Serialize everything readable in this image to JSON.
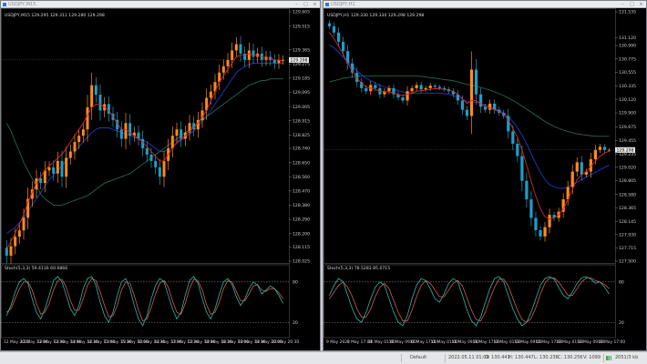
{
  "windows": [
    {
      "title": "USDJPY,M15",
      "symbol_line": "USDJPY,M15  129.295  129.311  129.280  129.298",
      "price_tag": "129.298",
      "y_ticks": [
        "129.605",
        "129.515",
        "129.365",
        "129.275",
        "129.185",
        "129.095",
        "129.005",
        "128.915",
        "128.825",
        "128.740",
        "128.650",
        "128.560",
        "128.470",
        "128.380",
        "128.290",
        "128.200",
        "128.115",
        "128.025"
      ],
      "time_labels": [
        "12 May 2022",
        "12 May 13:00",
        "12 May 13:30",
        "12 May 14:00",
        "12 May 14:30",
        "12 May 15:00",
        "12 May 15:30",
        "12 May 16:00",
        "12 May 16:30",
        "12 May 17:00",
        "12 May 17:30",
        "12 May 18:00",
        "12 May 18:30",
        "12 May 19:00",
        "12 May 19:30",
        "12 May 20:00",
        "12 May 20:30"
      ],
      "indicator_label": "Stoch(5,3,3) 59.4116 60.6866",
      "ind_levels": [
        "80",
        "20"
      ],
      "close_values": [
        128.06,
        128.12,
        128.18,
        128.22,
        128.3,
        128.42,
        128.48,
        128.55,
        128.52,
        128.6,
        128.62,
        128.58,
        128.66,
        128.56,
        128.68,
        128.72,
        128.78,
        128.82,
        128.86,
        129.0,
        129.14,
        129.08,
        128.98,
        129.02,
        128.96,
        128.92,
        128.86,
        128.8,
        128.9,
        128.82,
        128.84,
        128.8,
        128.74,
        128.7,
        128.66,
        128.62,
        128.56,
        128.66,
        128.74,
        128.82,
        128.86,
        128.8,
        128.84,
        128.9,
        128.86,
        128.92,
        128.98,
        129.06,
        129.1,
        129.16,
        129.22,
        129.26,
        129.3,
        129.36,
        129.4,
        129.34,
        129.3,
        129.36,
        129.32,
        129.34,
        129.3,
        129.32,
        129.3,
        129.28,
        129.3,
        129.3
      ],
      "ma_red": [
        128.1,
        128.15,
        128.2,
        128.26,
        128.32,
        128.4,
        128.46,
        128.52,
        128.56,
        128.6,
        128.63,
        128.65,
        128.68,
        128.7,
        128.74,
        128.78,
        128.82,
        128.86,
        128.9,
        128.95,
        129.0,
        129.02,
        129.02,
        129.0,
        128.98,
        128.94,
        128.9,
        128.86,
        128.86,
        128.84,
        128.82,
        128.8,
        128.78,
        128.75,
        128.72,
        128.69,
        128.66,
        128.66,
        128.7,
        128.74,
        128.78,
        128.8,
        128.82,
        128.85,
        128.87,
        128.9,
        128.94,
        128.98,
        129.04,
        129.1,
        129.16,
        129.2,
        129.24,
        129.28,
        129.32,
        129.33,
        129.33,
        129.34,
        129.33,
        129.33,
        129.32,
        129.31,
        129.31,
        129.3,
        129.3,
        129.29
      ],
      "ma_blue": [
        128.2,
        128.22,
        128.24,
        128.27,
        128.3,
        128.34,
        128.38,
        128.42,
        128.46,
        128.5,
        128.54,
        128.57,
        128.6,
        128.63,
        128.66,
        128.69,
        128.72,
        128.75,
        128.78,
        128.81,
        128.84,
        128.86,
        128.87,
        128.87,
        128.87,
        128.86,
        128.85,
        128.84,
        128.83,
        128.82,
        128.81,
        128.8,
        128.79,
        128.78,
        128.76,
        128.74,
        128.72,
        128.72,
        128.73,
        128.75,
        128.77,
        128.79,
        128.81,
        128.83,
        128.85,
        128.88,
        128.91,
        128.94,
        128.98,
        129.02,
        129.06,
        129.1,
        129.14,
        129.18,
        129.22,
        129.24,
        129.26,
        129.27,
        129.28,
        129.28,
        129.28,
        129.28,
        129.28,
        129.28,
        129.28,
        129.28
      ],
      "ma_green": [
        128.9,
        128.85,
        128.78,
        128.72,
        128.65,
        128.6,
        128.55,
        128.5,
        128.45,
        128.42,
        128.4,
        128.38,
        128.38,
        128.38,
        128.39,
        128.4,
        128.41,
        128.42,
        128.43,
        128.44,
        128.46,
        128.48,
        128.5,
        128.52,
        128.53,
        128.54,
        128.55,
        128.56,
        128.57,
        128.58,
        128.6,
        128.62,
        128.64,
        128.66,
        128.68,
        128.7,
        128.72,
        128.74,
        128.76,
        128.78,
        128.8,
        128.82,
        128.84,
        128.86,
        128.88,
        128.9,
        128.92,
        128.94,
        128.96,
        128.98,
        129.0,
        129.02,
        129.04,
        129.06,
        129.08,
        129.1,
        129.12,
        129.14,
        129.15,
        129.16,
        129.17,
        129.17,
        129.18,
        129.18,
        129.18,
        129.18
      ],
      "stoch_main": [
        30,
        45,
        65,
        80,
        85,
        78,
        55,
        35,
        25,
        40,
        60,
        82,
        88,
        80,
        60,
        40,
        30,
        45,
        70,
        85,
        88,
        75,
        50,
        30,
        20,
        35,
        60,
        80,
        85,
        70,
        45,
        25,
        15,
        30,
        55,
        75,
        85,
        80,
        60,
        40,
        25,
        35,
        60,
        82,
        88,
        78,
        55,
        35,
        25,
        40,
        62,
        80,
        85,
        76,
        58,
        45,
        55,
        70,
        80,
        75,
        62,
        68,
        74,
        70,
        60,
        48
      ],
      "stoch_signal": [
        35,
        40,
        55,
        70,
        80,
        80,
        68,
        48,
        32,
        35,
        48,
        68,
        82,
        84,
        72,
        52,
        38,
        38,
        55,
        75,
        85,
        82,
        65,
        45,
        28,
        30,
        45,
        68,
        80,
        78,
        60,
        38,
        22,
        25,
        42,
        62,
        78,
        82,
        72,
        52,
        35,
        32,
        48,
        70,
        84,
        82,
        68,
        46,
        32,
        35,
        50,
        70,
        82,
        80,
        66,
        52,
        52,
        62,
        74,
        76,
        68,
        66,
        70,
        70,
        64,
        55
      ]
    },
    {
      "title": "USDJPY,H1",
      "symbol_line": "USDJPY,H1  129.330  129.330  129.298  129.298",
      "price_tag": "129.298",
      "y_ticks": [
        "131.535",
        "131.120",
        "130.990",
        "130.775",
        "130.555",
        "130.335",
        "130.120",
        "129.900",
        "129.675",
        "129.455",
        "129.235",
        "129.020",
        "128.805",
        "128.580",
        "128.365",
        "128.145",
        "127.930",
        "127.715",
        "127.500"
      ],
      "time_labels": [
        "9 May 2022",
        "9 May 17:00",
        "10 May 01:00",
        "10 May 09:00",
        "10 May 17:00",
        "11 May 01:00",
        "11 May 09:00",
        "11 May 17:00",
        "12 May 01:00",
        "12 May 09:00",
        "12 May 17:00",
        "13 May 01:00",
        "13 May 09:00",
        "13 May 17:00"
      ],
      "indicator_label": "Stoch(5,3,3) 78.5283 85.0715",
      "ind_levels": [
        "80",
        "20"
      ],
      "close_values": [
        131.3,
        131.2,
        131.05,
        130.9,
        130.7,
        130.55,
        130.4,
        130.3,
        130.25,
        130.35,
        130.3,
        130.2,
        130.25,
        130.3,
        130.2,
        130.15,
        130.1,
        130.25,
        130.3,
        130.35,
        130.28,
        130.3,
        130.34,
        130.32,
        130.3,
        130.28,
        130.25,
        130.2,
        130.1,
        129.95,
        129.85,
        130.6,
        130.2,
        130.0,
        129.95,
        130.05,
        129.95,
        129.9,
        129.85,
        129.6,
        129.4,
        129.2,
        128.8,
        128.5,
        128.2,
        128.0,
        127.9,
        128.05,
        128.25,
        128.2,
        128.3,
        128.5,
        128.7,
        128.95,
        129.1,
        128.9,
        128.95,
        129.15,
        129.3,
        129.35,
        129.3,
        129.3
      ],
      "ma_red": [
        131.2,
        131.1,
        130.98,
        130.85,
        130.7,
        130.58,
        130.46,
        130.38,
        130.32,
        130.3,
        130.28,
        130.25,
        130.24,
        130.24,
        130.22,
        130.2,
        130.18,
        130.2,
        130.22,
        130.25,
        130.26,
        130.27,
        130.28,
        130.29,
        130.29,
        130.28,
        130.27,
        130.25,
        130.2,
        130.13,
        130.05,
        130.1,
        130.1,
        130.05,
        130.0,
        129.98,
        129.95,
        129.92,
        129.88,
        129.78,
        129.65,
        129.5,
        129.3,
        129.05,
        128.8,
        128.55,
        128.35,
        128.22,
        128.18,
        128.2,
        128.25,
        128.35,
        128.5,
        128.66,
        128.82,
        128.9,
        128.95,
        129.03,
        129.12,
        129.2,
        129.25,
        129.28
      ],
      "ma_blue": [
        131.0,
        130.95,
        130.88,
        130.8,
        130.72,
        130.65,
        130.58,
        130.52,
        130.46,
        130.42,
        130.38,
        130.35,
        130.32,
        130.3,
        130.28,
        130.26,
        130.24,
        130.23,
        130.22,
        130.22,
        130.22,
        130.22,
        130.22,
        130.22,
        130.22,
        130.21,
        130.2,
        130.18,
        130.15,
        130.12,
        130.08,
        130.08,
        130.07,
        130.05,
        130.03,
        130.0,
        129.97,
        129.94,
        129.9,
        129.84,
        129.76,
        129.66,
        129.54,
        129.4,
        129.24,
        129.08,
        128.94,
        128.82,
        128.74,
        128.7,
        128.68,
        128.68,
        128.7,
        128.74,
        128.78,
        128.82,
        128.86,
        128.9,
        128.94,
        128.98,
        129.02,
        129.05
      ],
      "ma_green": [
        130.4,
        130.42,
        130.44,
        130.46,
        130.47,
        130.48,
        130.49,
        130.5,
        130.5,
        130.5,
        130.5,
        130.5,
        130.5,
        130.5,
        130.5,
        130.5,
        130.5,
        130.5,
        130.5,
        130.5,
        130.49,
        130.48,
        130.47,
        130.46,
        130.45,
        130.44,
        130.43,
        130.42,
        130.4,
        130.38,
        130.36,
        130.35,
        130.33,
        130.31,
        130.29,
        130.27,
        130.24,
        130.21,
        130.18,
        130.14,
        130.1,
        130.06,
        130.01,
        129.96,
        129.91,
        129.86,
        129.81,
        129.76,
        129.72,
        129.68,
        129.65,
        129.62,
        129.6,
        129.58,
        129.56,
        129.55,
        129.54,
        129.53,
        129.52,
        129.52,
        129.52,
        129.52
      ],
      "stoch_main": [
        60,
        75,
        85,
        80,
        60,
        40,
        25,
        20,
        35,
        55,
        72,
        80,
        75,
        55,
        35,
        20,
        15,
        30,
        55,
        75,
        85,
        82,
        70,
        55,
        50,
        62,
        78,
        85,
        80,
        60,
        38,
        22,
        15,
        28,
        50,
        70,
        85,
        88,
        80,
        60,
        40,
        25,
        15,
        20,
        35,
        55,
        75,
        85,
        88,
        84,
        72,
        60,
        55,
        65,
        78,
        86,
        88,
        84,
        78,
        80,
        72,
        62
      ],
      "stoch_signal": [
        55,
        65,
        75,
        80,
        72,
        58,
        40,
        28,
        28,
        40,
        58,
        72,
        78,
        70,
        52,
        35,
        22,
        22,
        38,
        58,
        75,
        82,
        78,
        68,
        58,
        58,
        68,
        78,
        82,
        74,
        56,
        38,
        24,
        22,
        35,
        55,
        72,
        84,
        84,
        74,
        56,
        38,
        24,
        20,
        26,
        42,
        62,
        78,
        86,
        86,
        80,
        70,
        60,
        60,
        70,
        80,
        86,
        86,
        82,
        80,
        76,
        70
      ]
    }
  ],
  "status_bar": {
    "profile": "Default",
    "datetime": "2022.05.11 01:00",
    "open": "O: 130.441",
    "high": "H: 130.447",
    "low": "L: 130.236",
    "close": "C: 130.256",
    "volume": "V: 1099",
    "traffic": "2051/3 kb"
  },
  "colors": {
    "bull": "#ff8a1e",
    "bear": "#1e9ec8",
    "ma_red": "#d42a2a",
    "ma_blue": "#1c3cc8",
    "ma_green": "#1f6a48",
    "stoch_main": "#2fb6a6",
    "stoch_signal": "#d45a5a",
    "grid": "#7a7a7a"
  }
}
